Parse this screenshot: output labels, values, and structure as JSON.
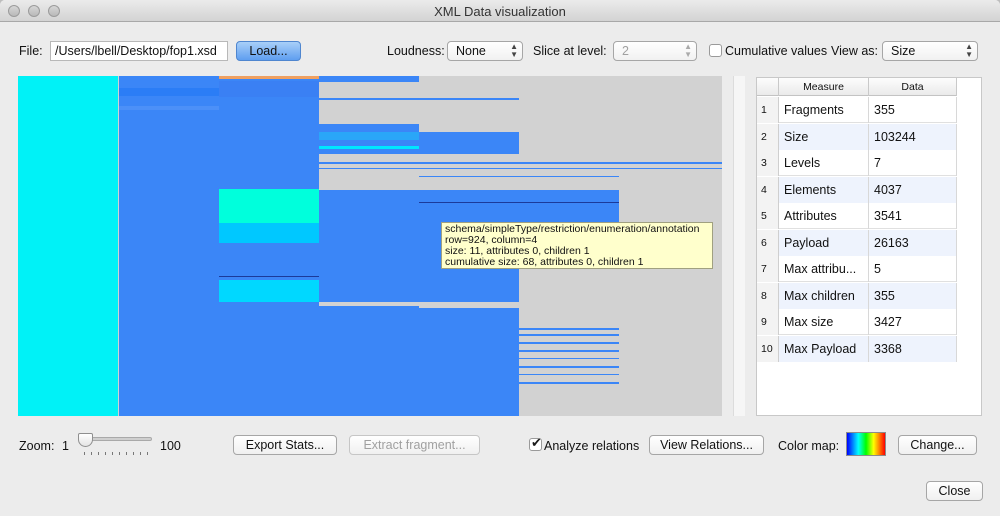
{
  "window": {
    "title": "XML Data visualization"
  },
  "toolbar": {
    "file_label": "File:",
    "file_path": "/Users/lbell/Desktop/fop1.xsd",
    "load_button": "Load...",
    "loudness_label": "Loudness:",
    "loudness_value": "None",
    "slice_label": "Slice at level:",
    "slice_value": "2",
    "cumulative_label": "Cumulative values",
    "view_as_label": "View as:",
    "view_as_value": "Size"
  },
  "tooltip": {
    "lines": [
      "schema/simpleType/restriction/enumeration/annotation",
      "row=924, column=4",
      "size: 11, attributes 0, children 1",
      "cumulative size: 68, attributes 0, children 1"
    ]
  },
  "stats_table": {
    "headers": [
      "Measure",
      "Data"
    ],
    "rows": [
      {
        "index": "1",
        "measure": "Fragments",
        "data": "355"
      },
      {
        "index": "2",
        "measure": "Size",
        "data": "103244"
      },
      {
        "index": "3",
        "measure": "Levels",
        "data": "7"
      },
      {
        "index": "4",
        "measure": "Elements",
        "data": "4037"
      },
      {
        "index": "5",
        "measure": "Attributes",
        "data": "3541"
      },
      {
        "index": "6",
        "measure": "Payload",
        "data": "26163"
      },
      {
        "index": "7",
        "measure": "Max attribu...",
        "data": "5"
      },
      {
        "index": "8",
        "measure": "Max children",
        "data": "355"
      },
      {
        "index": "9",
        "measure": "Max size",
        "data": "3427"
      },
      {
        "index": "10",
        "measure": "Max Payload",
        "data": "3368"
      }
    ]
  },
  "bottom": {
    "zoom_label": "Zoom:",
    "zoom_min": "1",
    "zoom_max": "100",
    "zoom_value": 1,
    "export_button": "Export Stats...",
    "extract_button": "Extract fragment...",
    "analyze_label": "Analyze relations",
    "analyze_checked": true,
    "view_relations_button": "View Relations...",
    "color_map_label": "Color map:",
    "change_button": "Change...",
    "close_button": "Close"
  },
  "colors": {
    "level1": "#00f2f7",
    "level2": "#3b86f7",
    "accent_orange": "#f0a060",
    "dark_line": "#1b3a9a",
    "background": "#d2d2d2"
  }
}
